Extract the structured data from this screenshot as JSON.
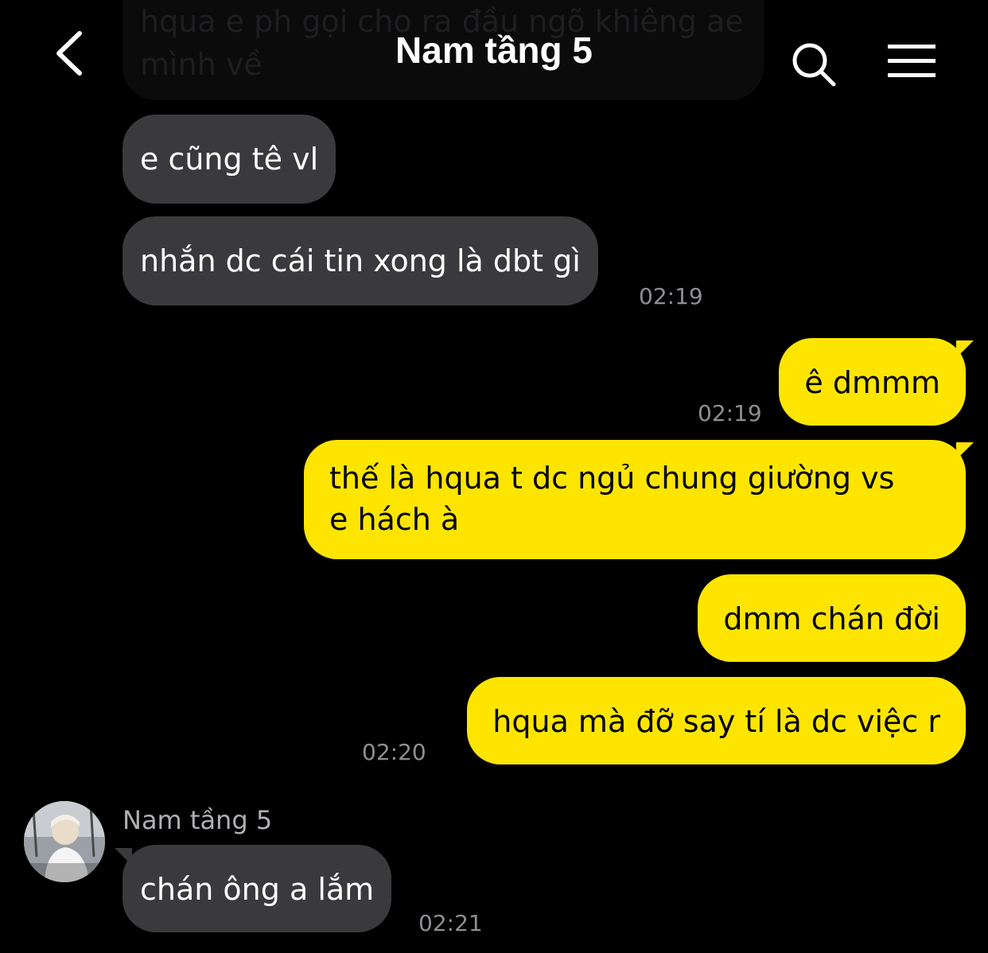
{
  "header": {
    "title": "Nam tầng 5",
    "back_icon": "chevron-left-icon",
    "search_icon": "search-icon",
    "menu_icon": "hamburger-menu-icon"
  },
  "messages": [
    {
      "id": "m0",
      "direction": "in",
      "text": "hqua e ph gọi cho ra đầu ngõ khiêng ae mình về",
      "faded": true
    },
    {
      "id": "m1",
      "direction": "in",
      "text": "e cũng tê vl"
    },
    {
      "id": "m2",
      "direction": "in",
      "text": "nhắn dc cái tin xong là dbt gì",
      "time": "02:19"
    },
    {
      "id": "m3",
      "direction": "out",
      "text": "ê dmmm",
      "time": "02:19"
    },
    {
      "id": "m4",
      "direction": "out",
      "text_line1": "thế là hqua t dc ngủ chung giường vs",
      "text_line2": "e hách à"
    },
    {
      "id": "m5",
      "direction": "out",
      "text": "dmm chán đời"
    },
    {
      "id": "m6",
      "direction": "out",
      "text": "hqua mà đỡ say tí là dc việc r",
      "time": "02:20"
    },
    {
      "id": "m7",
      "direction": "in",
      "sender": "Nam tầng 5",
      "text": "chán ông a lắm",
      "time": "02:21"
    }
  ],
  "colors": {
    "background": "#000000",
    "incoming_bubble": "#3a3a3c",
    "outgoing_bubble": "#fde500",
    "timestamp": "#8e8e93"
  }
}
